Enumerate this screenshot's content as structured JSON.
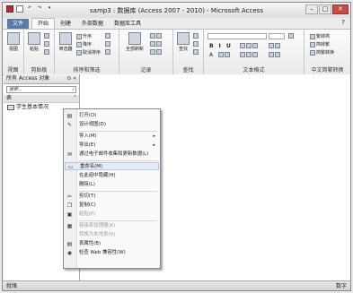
{
  "window": {
    "title": "samp3 : 数据库 (Access 2007 - 2010) - Microsoft Access",
    "minimize": "–",
    "maximize": "□",
    "close": "✕"
  },
  "tabs": [
    {
      "label": "文件"
    },
    {
      "label": "开始"
    },
    {
      "label": "创建"
    },
    {
      "label": "外部数据"
    },
    {
      "label": "数据库工具"
    }
  ],
  "help_icon": "?",
  "ribbon": {
    "groups": [
      {
        "label": "视图"
      },
      {
        "label": "剪贴板"
      },
      {
        "label": "排序和筛选"
      },
      {
        "label": "记录"
      },
      {
        "label": "查找"
      },
      {
        "label": "文本格式"
      },
      {
        "label": "中文简繁转换"
      }
    ],
    "buttons": {
      "view": "视图",
      "paste": "粘贴",
      "filter": "筛选器",
      "asc": "升序",
      "desc": "降序",
      "remove_sort": "取消排序",
      "refresh_all": "全部刷新",
      "find": "查找",
      "trad_to_simp": "繁转简",
      "simp_to_trad": "简转繁",
      "convert": "简繁转换"
    }
  },
  "nav": {
    "header": "所有 Access 对象",
    "search_placeholder": "搜索...",
    "section": "表",
    "items": [
      "学生基本情况"
    ]
  },
  "context_menu": [
    {
      "label": "打开(O)",
      "icon": "open-icon",
      "glyph": "▤"
    },
    {
      "label": "设计视图(D)",
      "icon": "design-view-icon",
      "glyph": "✎"
    },
    {
      "label": "导入(M)",
      "submenu": true
    },
    {
      "label": "导出(E)",
      "submenu": true
    },
    {
      "label": "通过电子邮件收集和更新数据(L)",
      "icon": "email-collect-icon",
      "glyph": "✉"
    },
    {
      "label": "重命名(M)",
      "icon": "rename-icon",
      "glyph": "▭",
      "highlight": true
    },
    {
      "label": "在此组中隐藏(H)"
    },
    {
      "label": "删除(L)"
    },
    {
      "label": "剪切(T)",
      "icon": "cut-icon",
      "glyph": "✂"
    },
    {
      "label": "复制(C)",
      "icon": "copy-icon",
      "glyph": "❐"
    },
    {
      "label": "粘贴(P)",
      "icon": "paste-icon",
      "glyph": "▣",
      "disabled": true
    },
    {
      "label": "链接表管理器(K)",
      "icon": "link-manager-icon",
      "glyph": "▦",
      "disabled": true
    },
    {
      "label": "转换为本地表(V)",
      "disabled": true
    },
    {
      "label": "表属性(B)",
      "icon": "table-properties-icon",
      "glyph": "▤"
    },
    {
      "label": "检查 Web 兼容性(W)",
      "icon": "web-check-icon",
      "glyph": "◉"
    }
  ],
  "status": {
    "left": "就绪",
    "right": "数字"
  }
}
